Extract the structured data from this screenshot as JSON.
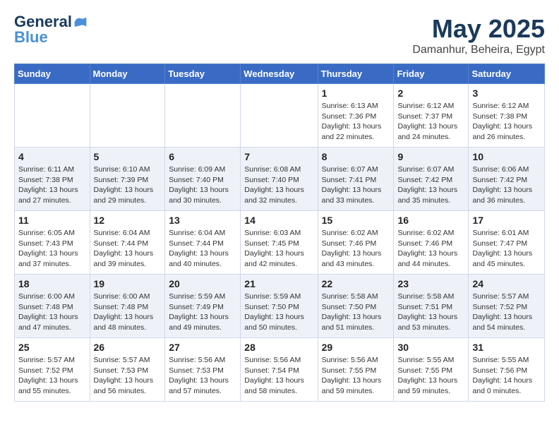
{
  "logo": {
    "line1": "General",
    "line2": "Blue"
  },
  "title": "May 2025",
  "location": "Damanhur, Beheira, Egypt",
  "weekdays": [
    "Sunday",
    "Monday",
    "Tuesday",
    "Wednesday",
    "Thursday",
    "Friday",
    "Saturday"
  ],
  "weeks": [
    [
      {
        "day": "",
        "info": ""
      },
      {
        "day": "",
        "info": ""
      },
      {
        "day": "",
        "info": ""
      },
      {
        "day": "",
        "info": ""
      },
      {
        "day": "1",
        "info": "Sunrise: 6:13 AM\nSunset: 7:36 PM\nDaylight: 13 hours\nand 22 minutes."
      },
      {
        "day": "2",
        "info": "Sunrise: 6:12 AM\nSunset: 7:37 PM\nDaylight: 13 hours\nand 24 minutes."
      },
      {
        "day": "3",
        "info": "Sunrise: 6:12 AM\nSunset: 7:38 PM\nDaylight: 13 hours\nand 26 minutes."
      }
    ],
    [
      {
        "day": "4",
        "info": "Sunrise: 6:11 AM\nSunset: 7:38 PM\nDaylight: 13 hours\nand 27 minutes."
      },
      {
        "day": "5",
        "info": "Sunrise: 6:10 AM\nSunset: 7:39 PM\nDaylight: 13 hours\nand 29 minutes."
      },
      {
        "day": "6",
        "info": "Sunrise: 6:09 AM\nSunset: 7:40 PM\nDaylight: 13 hours\nand 30 minutes."
      },
      {
        "day": "7",
        "info": "Sunrise: 6:08 AM\nSunset: 7:40 PM\nDaylight: 13 hours\nand 32 minutes."
      },
      {
        "day": "8",
        "info": "Sunrise: 6:07 AM\nSunset: 7:41 PM\nDaylight: 13 hours\nand 33 minutes."
      },
      {
        "day": "9",
        "info": "Sunrise: 6:07 AM\nSunset: 7:42 PM\nDaylight: 13 hours\nand 35 minutes."
      },
      {
        "day": "10",
        "info": "Sunrise: 6:06 AM\nSunset: 7:42 PM\nDaylight: 13 hours\nand 36 minutes."
      }
    ],
    [
      {
        "day": "11",
        "info": "Sunrise: 6:05 AM\nSunset: 7:43 PM\nDaylight: 13 hours\nand 37 minutes."
      },
      {
        "day": "12",
        "info": "Sunrise: 6:04 AM\nSunset: 7:44 PM\nDaylight: 13 hours\nand 39 minutes."
      },
      {
        "day": "13",
        "info": "Sunrise: 6:04 AM\nSunset: 7:44 PM\nDaylight: 13 hours\nand 40 minutes."
      },
      {
        "day": "14",
        "info": "Sunrise: 6:03 AM\nSunset: 7:45 PM\nDaylight: 13 hours\nand 42 minutes."
      },
      {
        "day": "15",
        "info": "Sunrise: 6:02 AM\nSunset: 7:46 PM\nDaylight: 13 hours\nand 43 minutes."
      },
      {
        "day": "16",
        "info": "Sunrise: 6:02 AM\nSunset: 7:46 PM\nDaylight: 13 hours\nand 44 minutes."
      },
      {
        "day": "17",
        "info": "Sunrise: 6:01 AM\nSunset: 7:47 PM\nDaylight: 13 hours\nand 45 minutes."
      }
    ],
    [
      {
        "day": "18",
        "info": "Sunrise: 6:00 AM\nSunset: 7:48 PM\nDaylight: 13 hours\nand 47 minutes."
      },
      {
        "day": "19",
        "info": "Sunrise: 6:00 AM\nSunset: 7:48 PM\nDaylight: 13 hours\nand 48 minutes."
      },
      {
        "day": "20",
        "info": "Sunrise: 5:59 AM\nSunset: 7:49 PM\nDaylight: 13 hours\nand 49 minutes."
      },
      {
        "day": "21",
        "info": "Sunrise: 5:59 AM\nSunset: 7:50 PM\nDaylight: 13 hours\nand 50 minutes."
      },
      {
        "day": "22",
        "info": "Sunrise: 5:58 AM\nSunset: 7:50 PM\nDaylight: 13 hours\nand 51 minutes."
      },
      {
        "day": "23",
        "info": "Sunrise: 5:58 AM\nSunset: 7:51 PM\nDaylight: 13 hours\nand 53 minutes."
      },
      {
        "day": "24",
        "info": "Sunrise: 5:57 AM\nSunset: 7:52 PM\nDaylight: 13 hours\nand 54 minutes."
      }
    ],
    [
      {
        "day": "25",
        "info": "Sunrise: 5:57 AM\nSunset: 7:52 PM\nDaylight: 13 hours\nand 55 minutes."
      },
      {
        "day": "26",
        "info": "Sunrise: 5:57 AM\nSunset: 7:53 PM\nDaylight: 13 hours\nand 56 minutes."
      },
      {
        "day": "27",
        "info": "Sunrise: 5:56 AM\nSunset: 7:53 PM\nDaylight: 13 hours\nand 57 minutes."
      },
      {
        "day": "28",
        "info": "Sunrise: 5:56 AM\nSunset: 7:54 PM\nDaylight: 13 hours\nand 58 minutes."
      },
      {
        "day": "29",
        "info": "Sunrise: 5:56 AM\nSunset: 7:55 PM\nDaylight: 13 hours\nand 59 minutes."
      },
      {
        "day": "30",
        "info": "Sunrise: 5:55 AM\nSunset: 7:55 PM\nDaylight: 13 hours\nand 59 minutes."
      },
      {
        "day": "31",
        "info": "Sunrise: 5:55 AM\nSunset: 7:56 PM\nDaylight: 14 hours\nand 0 minutes."
      }
    ]
  ]
}
